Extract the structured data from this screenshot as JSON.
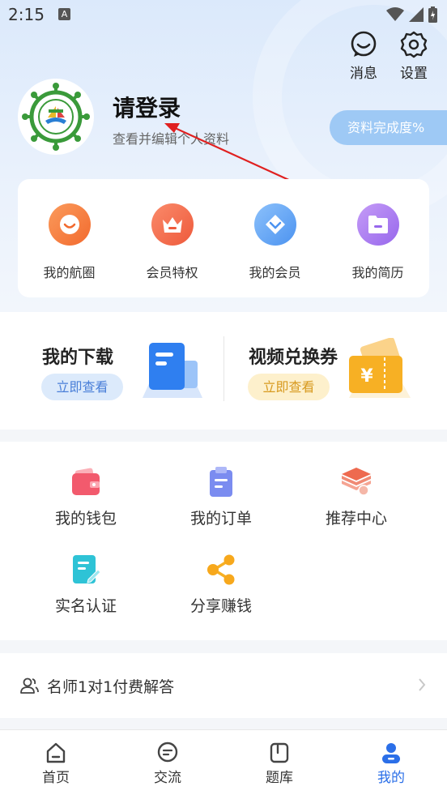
{
  "status_bar": {
    "time": "2:15",
    "notif_badge": "A"
  },
  "header": {
    "messages_label": "消息",
    "settings_label": "设置",
    "login_title": "请登录",
    "login_subtitle": "查看并编辑个人资料",
    "profile_completion": "资料完成度%"
  },
  "quick_actions": [
    {
      "label": "我的航圈",
      "icon": "smile-face-icon",
      "color": "#f77c43"
    },
    {
      "label": "会员特权",
      "icon": "crown-icon",
      "color": "#f2694f"
    },
    {
      "label": "我的会员",
      "icon": "diamond-icon",
      "color": "#5ea3f5"
    },
    {
      "label": "我的简历",
      "icon": "folder-icon",
      "color": "#a77ef0"
    }
  ],
  "promos": {
    "download": {
      "title": "我的下载",
      "button": "立即查看"
    },
    "coupon": {
      "title": "视频兑换券",
      "button": "立即查看"
    }
  },
  "services": [
    {
      "label": "我的钱包",
      "icon": "wallet-icon"
    },
    {
      "label": "我的订单",
      "icon": "clipboard-icon"
    },
    {
      "label": "推荐中心",
      "icon": "layers-icon"
    },
    {
      "label": "实名认证",
      "icon": "id-edit-icon"
    },
    {
      "label": "分享赚钱",
      "icon": "share-icon"
    }
  ],
  "list": {
    "consult_label": "名师1对1付费解答"
  },
  "tabbar": [
    {
      "label": "首页",
      "icon": "home-icon"
    },
    {
      "label": "交流",
      "icon": "chat-icon"
    },
    {
      "label": "题库",
      "icon": "book-icon"
    },
    {
      "label": "我的",
      "icon": "user-icon",
      "active": true
    }
  ],
  "colors": {
    "accent": "#2b6fe8",
    "download_btn_text": "#4a7fd8",
    "coupon_btn_text": "#d89a1f"
  }
}
